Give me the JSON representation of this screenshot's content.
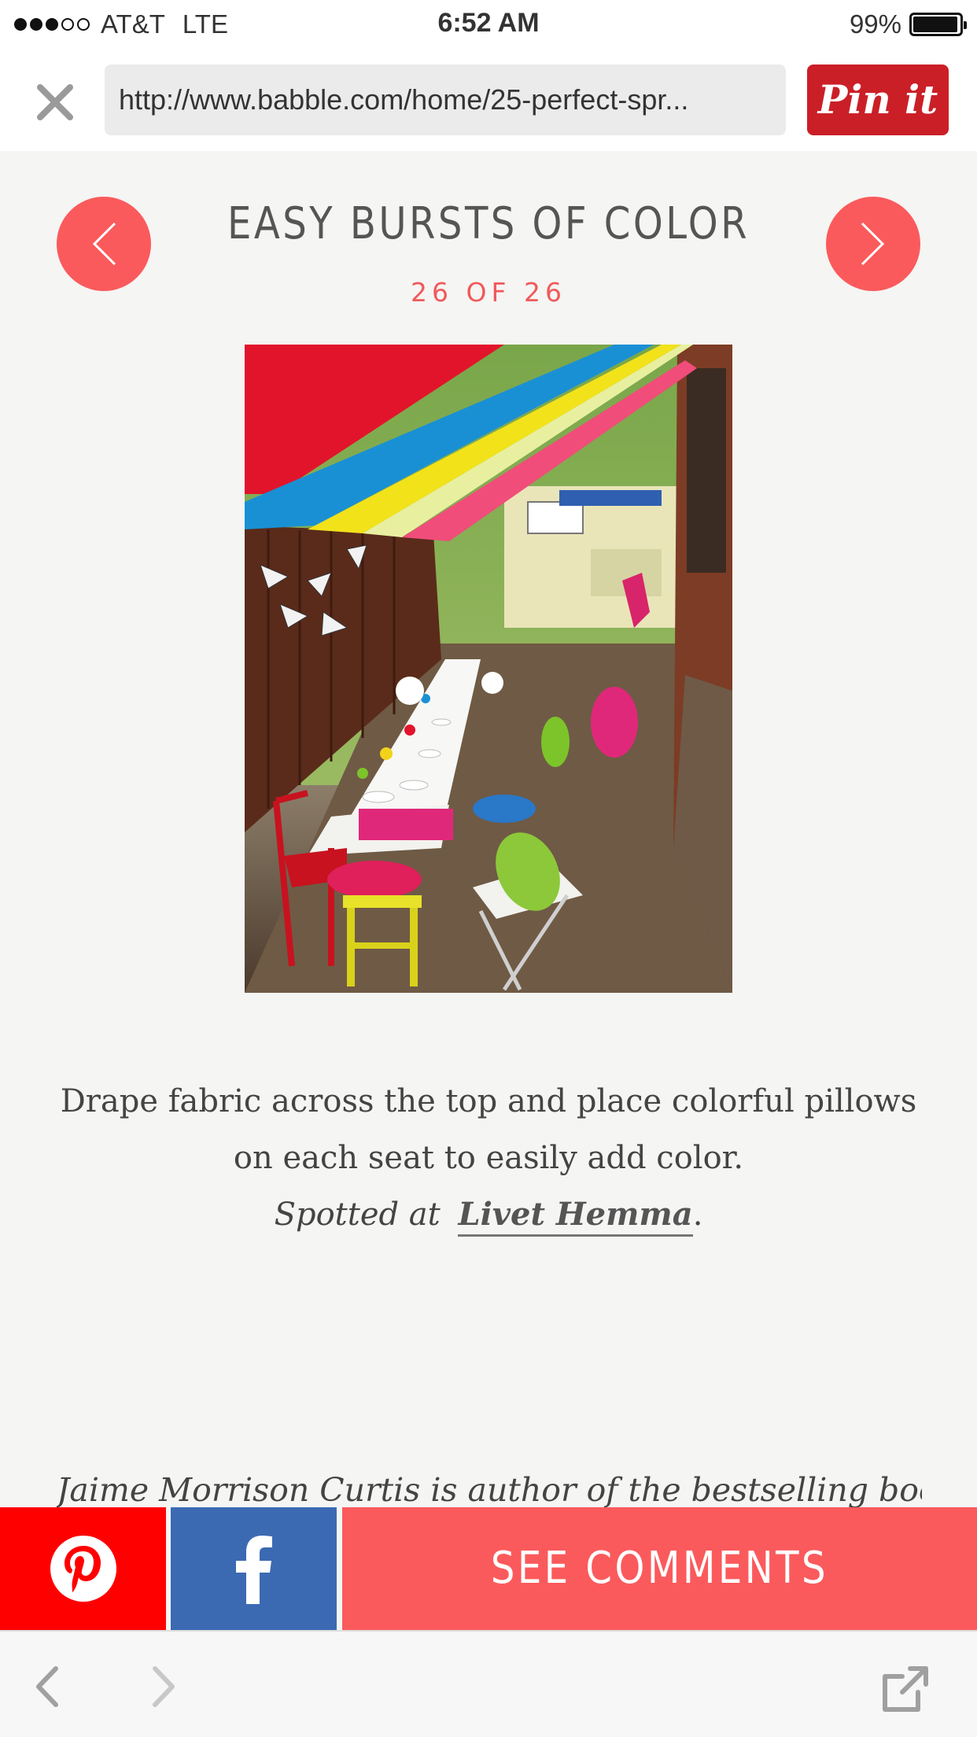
{
  "status_bar": {
    "carrier": "AT&T",
    "network": "LTE",
    "time": "6:52 AM",
    "battery": "99%",
    "signal_bars_filled": 3,
    "signal_bars_total": 5,
    "battery_level": 0.99
  },
  "browser": {
    "url": "http://www.babble.com/home/25-perfect-spr...",
    "pin_button_label": "Pin it",
    "close_icon": "close-icon"
  },
  "slide": {
    "title": "EASY BURSTS OF COLOR",
    "counter": "26 OF 26",
    "caption_line1": "Drape fabric across the top and place colorful pillows",
    "caption_line2": "on each seat to easily add color.",
    "spotted_prefix": "Spotted at",
    "spotted_link": "Livet Hemma",
    "spotted_suffix": ".",
    "author_line": "Jaime Morrison Curtis is author of the bestselling book"
  },
  "share": {
    "pinterest_icon": "pinterest-icon",
    "facebook_icon": "facebook-icon",
    "comments_label": "SEE COMMENTS"
  },
  "colors": {
    "accent": "#fb5a5c",
    "pin_red": "#cb1f27",
    "pinterest_red": "#ff0000",
    "facebook_blue": "#3b6ab3"
  }
}
